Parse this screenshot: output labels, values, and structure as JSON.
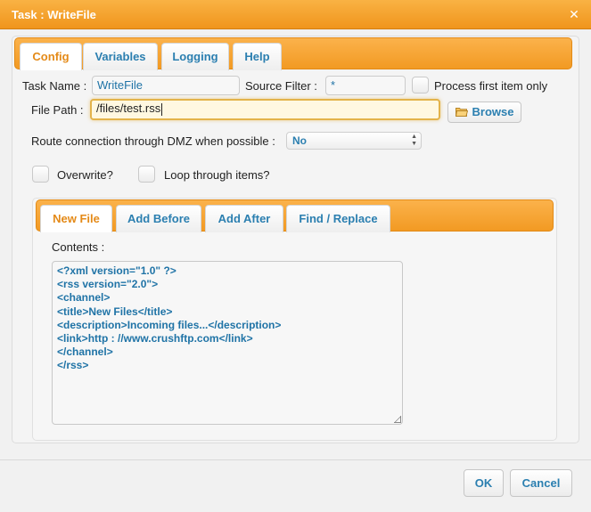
{
  "window": {
    "title": "Task : WriteFile",
    "close_glyph": "✕"
  },
  "main_tabs": [
    {
      "label": "Config",
      "active": true
    },
    {
      "label": "Variables"
    },
    {
      "label": "Logging"
    },
    {
      "label": "Help"
    }
  ],
  "form": {
    "task_name_label": "Task Name :",
    "task_name_value": "WriteFile",
    "source_filter_label": "Source Filter :",
    "source_filter_value": "*",
    "process_first_label": "Process first item only",
    "file_path_label": "File Path :",
    "file_path_value": "/files/test.rss",
    "browse_label": "Browse",
    "dmz_label": "Route connection through DMZ when possible :",
    "dmz_value": "No",
    "overwrite_label": "Overwrite?",
    "loop_label": "Loop through items?"
  },
  "sub_tabs": [
    {
      "label": "New File",
      "active": true
    },
    {
      "label": "Add Before"
    },
    {
      "label": "Add After"
    },
    {
      "label": "Find / Replace"
    }
  ],
  "contents": {
    "label": "Contents :",
    "text": "<?xml version=\"1.0\" ?>\n<rss version=\"2.0\">\n<channel>\n<title>New Files</title>\n<description>Incoming files...</description>\n<link>http : //www.crushftp.com</link>\n</channel>\n</rss>"
  },
  "footer": {
    "ok_label": "OK",
    "cancel_label": "Cancel"
  },
  "colors": {
    "accent": "#f29a23",
    "link": "#2b7fb0",
    "active_tab": "#e48a18"
  },
  "icons": {
    "close": "close-icon",
    "browse": "folder-icon",
    "select": "chevron-updown-icon"
  }
}
